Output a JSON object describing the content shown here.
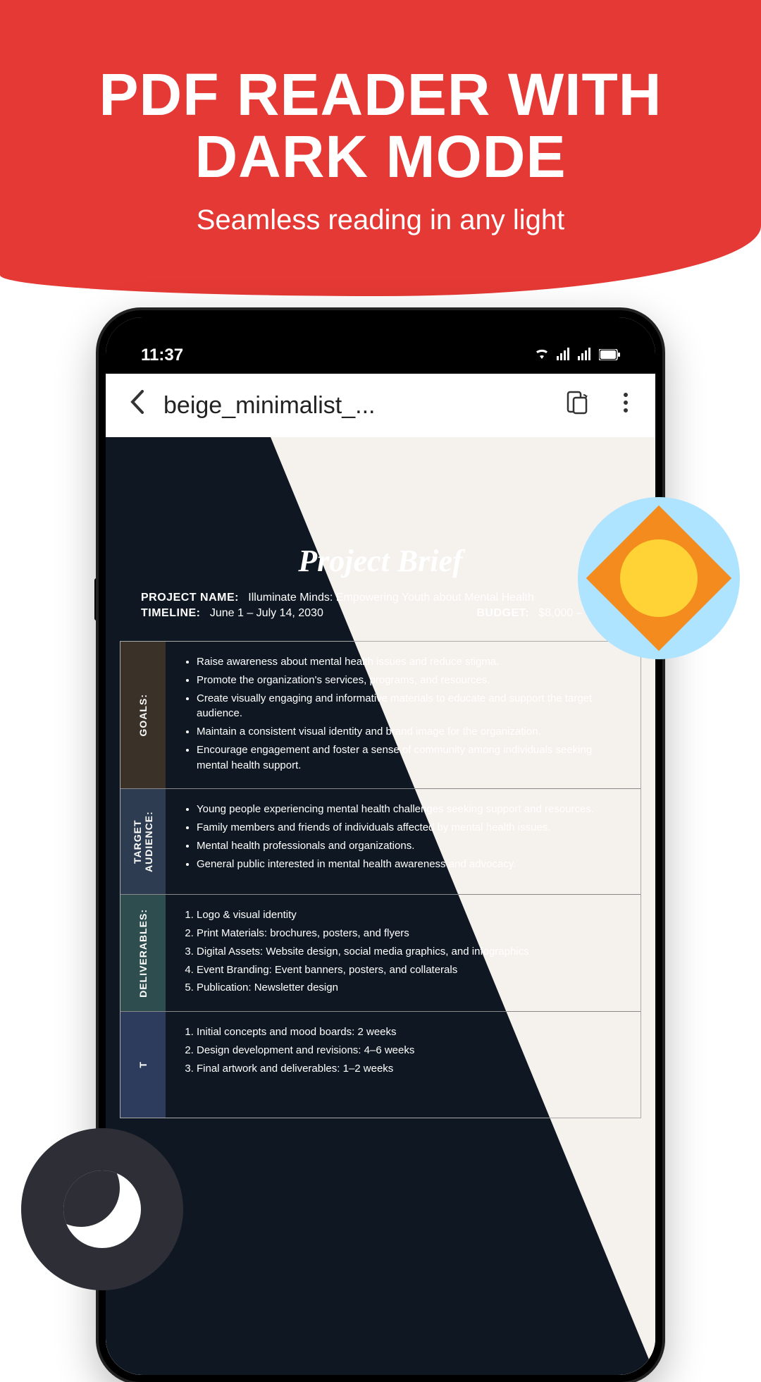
{
  "header": {
    "title_line1": "PDF READER WITH",
    "title_line2": "DARK MODE",
    "subtitle": "Seamless reading in any light"
  },
  "status_bar": {
    "time": "11:37"
  },
  "app_bar": {
    "document_title": "beige_minimalist_..."
  },
  "document": {
    "title": "Project Brief",
    "project_name_label": "PROJECT NAME:",
    "project_name": "Illuminate Minds: Empowering Youth about Mental Health",
    "timeline_label": "TIMELINE:",
    "timeline": "June 1 – July 14, 2030",
    "budget_label": "BUDGET:",
    "budget": "$8,000 – 10,000",
    "sections": {
      "goals": {
        "label": "GOALS:",
        "items": [
          "Raise awareness about mental health issues and reduce stigma.",
          "Promote the organization's services, programs, and resources.",
          "Create visually engaging and informative materials to educate and support the target audience.",
          "Maintain a consistent visual identity and brand image for the organization.",
          "Encourage engagement and foster a sense of community among individuals seeking mental health support."
        ]
      },
      "target": {
        "label": "TARGET AUDIENCE:",
        "items": [
          "Young people experiencing mental health challenges seeking support and resources.",
          "Family members and friends of individuals affected by mental health issues.",
          "Mental health professionals and organizations.",
          "General public interested in mental health awareness and advocacy."
        ]
      },
      "deliverables": {
        "label": "DELIVERABLES:",
        "items": [
          "Logo & visual identity",
          "Print Materials: brochures, posters, and flyers",
          "Digital Assets: Website design, social media graphics, and infographics",
          "Event Branding: Event banners, posters, and collaterals",
          "Publication: Newsletter design"
        ]
      },
      "timeline_sec": {
        "label": "T",
        "items": [
          "Initial concepts and mood boards: 2 weeks",
          "Design development and revisions: 4–6 weeks",
          "Final artwork and deliverables: 1–2 weeks"
        ]
      }
    }
  }
}
